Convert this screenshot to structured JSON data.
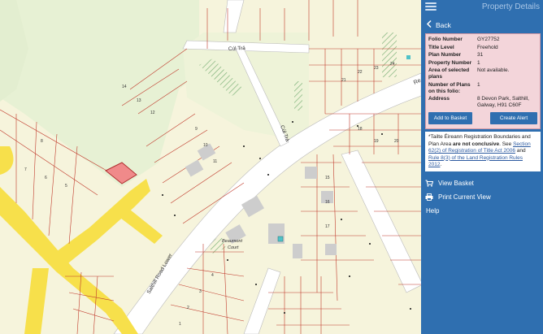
{
  "panel": {
    "title": "Property Details",
    "back_label": "Back",
    "fields": [
      {
        "key": "Folio Number",
        "value": "GY27752"
      },
      {
        "key": "Title Level",
        "value": "Freehold"
      },
      {
        "key": "Plan Number",
        "value": "31"
      },
      {
        "key": "Property Number",
        "value": "1"
      },
      {
        "key": "Area of selected plans",
        "value": "Not available."
      },
      {
        "key": "Number of Plans on this folio:",
        "value": "1"
      },
      {
        "key": "Address",
        "value": "8 Devon Park, Salthill, Galway, H91 C60F"
      }
    ],
    "add_to_basket": "Add to Basket",
    "create_alert": "Create Alert",
    "note": {
      "p1": "*Tailte Éireann Registration Boundaries and Plan Area ",
      "bold": "are not conclusive",
      "p2": ". See ",
      "link1": "Section 62(2) of Registration of Title Act 2006",
      "p3": " and ",
      "link2": "Rule 8(3) of the Land Registration Rules 2012",
      "p4": "."
    },
    "menu": [
      {
        "label": "View Basket",
        "icon": "cart-icon"
      },
      {
        "label": "Print Current View",
        "icon": "print-icon"
      },
      {
        "label": "Help",
        "icon": ""
      }
    ]
  },
  "map": {
    "labels": {
      "cul_tra_1": "Cúl Trá",
      "cul_tra_2": "Cúl Trá",
      "salthill_road": "Salthill Road Lower",
      "beaumont_1": "Beaumont",
      "beaumont_2": "Court",
      "re": "Re"
    },
    "numbers": [
      "14",
      "13",
      "12",
      "11",
      "10",
      "9",
      "15",
      "16",
      "17",
      "18",
      "19",
      "20",
      "8",
      "7",
      "6",
      "5",
      "4",
      "3",
      "2",
      "1",
      "21",
      "22",
      "23",
      "24"
    ],
    "colors": {
      "road": "#ffffff",
      "major_road": "#f7e04b",
      "green": "#e6f2d2",
      "parcel_line": "#c0392b",
      "selected": "#f08a8a",
      "water": "#9fd6e0"
    }
  }
}
